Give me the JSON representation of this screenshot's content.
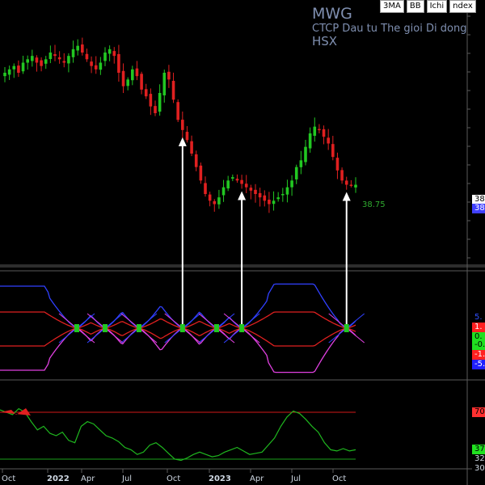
{
  "header": {
    "symbol": "MWG",
    "company": "CTCP Dau tu The gioi Di dong",
    "exchange": "HSX",
    "buttons": [
      "3MA",
      "BB",
      "Ichi",
      "ndex"
    ]
  },
  "last_price_label": "38.75",
  "price_axis_labels": [
    {
      "text": "38",
      "bg": "#ffffff",
      "fg": "#000000"
    },
    {
      "text": "38",
      "bg": "#4040ff",
      "fg": "#ffffff"
    }
  ],
  "osc_axis_labels": [
    {
      "text": "5.",
      "bg": "#000000",
      "fg": "#3050ff"
    },
    {
      "text": "1.",
      "bg": "#ff2020",
      "fg": "#ffffff"
    },
    {
      "text": "0.",
      "bg": "#20e020",
      "fg": "#000000"
    },
    {
      "text": "-0.",
      "bg": "#20e020",
      "fg": "#000000"
    },
    {
      "text": "-1.",
      "bg": "#ff2020",
      "fg": "#ffffff"
    },
    {
      "text": "-5.",
      "bg": "#2020ff",
      "fg": "#ffffff"
    }
  ],
  "rsi_axis_labels": [
    {
      "text": "70",
      "bg": "#ff3030",
      "fg": "#000000"
    },
    {
      "text": "37",
      "bg": "#20e020",
      "fg": "#000000"
    },
    {
      "text": "32",
      "bg": "#000000",
      "fg": "#cfd8e3"
    },
    {
      "text": "30",
      "bg": "#000000",
      "fg": "#cfd8e3"
    }
  ],
  "x_axis_labels": [
    {
      "text": "Oct",
      "bold": false
    },
    {
      "text": "2022",
      "bold": true
    },
    {
      "text": "Apr",
      "bold": false
    },
    {
      "text": "Jul",
      "bold": false
    },
    {
      "text": "Oct",
      "bold": false
    },
    {
      "text": "2023",
      "bold": true
    },
    {
      "text": "Apr",
      "bold": false
    },
    {
      "text": "Jul",
      "bold": false
    },
    {
      "text": "Oct",
      "bold": false
    }
  ],
  "colors": {
    "up": "#22c722",
    "down": "#e02020",
    "bb_upper": "#3040ff",
    "bb_lower": "#e040e0",
    "rsi": "#1fb81f",
    "level70": "#d01818",
    "level30": "#1aa01a",
    "arrow": "#ffffff"
  },
  "chart_data": {
    "type": "candlestick",
    "price_series": [
      72,
      73,
      74,
      72,
      75,
      76,
      77,
      75,
      74,
      76,
      78,
      77,
      76,
      75,
      77,
      79,
      80,
      78,
      76,
      74,
      73,
      75,
      78,
      79,
      77,
      72,
      68,
      70,
      73,
      71,
      67,
      65,
      62,
      60,
      66,
      72,
      70,
      64,
      58,
      55,
      52,
      48,
      44,
      40,
      36,
      34,
      33,
      35,
      38,
      40,
      41,
      40,
      39,
      38,
      37,
      36,
      35,
      34,
      33,
      34,
      35,
      36,
      38,
      40,
      44,
      46,
      50,
      54,
      56,
      55,
      53,
      51,
      47,
      43,
      40,
      38.75,
      38.6,
      38.75
    ],
    "rsi_series": [
      72,
      70,
      68,
      73,
      70,
      62,
      55,
      58,
      52,
      50,
      53,
      46,
      44,
      58,
      62,
      60,
      55,
      50,
      48,
      45,
      40,
      38,
      34,
      36,
      42,
      44,
      40,
      35,
      30,
      29,
      31,
      34,
      36,
      34,
      32,
      33,
      36,
      38,
      40,
      37,
      34,
      35,
      36,
      42,
      48,
      58,
      66,
      71,
      69,
      64,
      58,
      53,
      44,
      38,
      37,
      39,
      37,
      38
    ],
    "rsi_levels": [
      70,
      30
    ],
    "signal_indices": [
      39,
      52,
      75
    ]
  }
}
